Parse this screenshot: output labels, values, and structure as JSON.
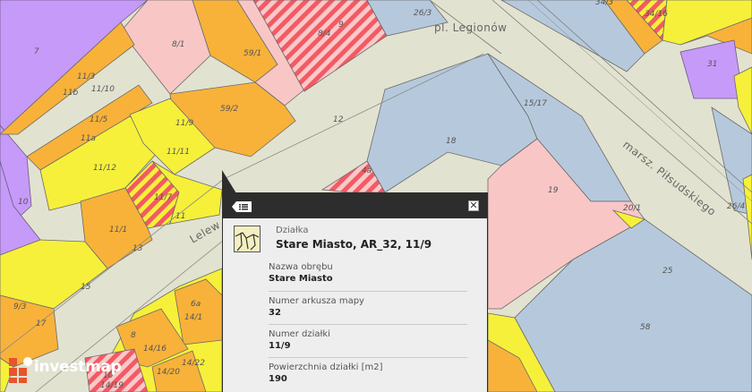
{
  "map": {
    "streets": [
      "pl. Legionów",
      "marsz. Piłsudskiego",
      "Lelew"
    ],
    "parcel_labels": [
      "7",
      "8/1",
      "8/4",
      "9",
      "26/3",
      "34/3",
      "34/16",
      "59/1",
      "59/2",
      "11/3",
      "11b",
      "11/10",
      "11/5",
      "11a",
      "11/12",
      "11/11",
      "11/9",
      "11/7",
      "11",
      "12",
      "15/17",
      "18",
      "4a",
      "19",
      "20/1",
      "26/4",
      "31",
      "10",
      "11/1",
      "13",
      "15",
      "9/3",
      "17",
      "6a",
      "14/1",
      "8",
      "14/16",
      "14/22",
      "14/20",
      "10",
      "14/19",
      "25",
      "58"
    ],
    "colors": {
      "purple": "#c69af8",
      "orange": "#f8b23a",
      "yellow": "#f6f03a",
      "pink": "#f9c6c6",
      "blue": "#b6c9dc",
      "road": "#e2e2d0",
      "hatch": "#f35a64"
    }
  },
  "popup": {
    "list_icon": "list-icon",
    "close_icon": "close-icon",
    "close_glyph": "✕",
    "type": "Działka",
    "title": "Stare Miasto, AR_32, 11/9",
    "fields": [
      {
        "label": "Nazwa obrębu",
        "value": "Stare Miasto"
      },
      {
        "label": "Numer arkusza mapy",
        "value": "32"
      },
      {
        "label": "Numer działki",
        "value": "11/9"
      },
      {
        "label": "Powierzchnia działki [m2]",
        "value": "190"
      }
    ]
  },
  "logo": {
    "text": "investmap"
  }
}
